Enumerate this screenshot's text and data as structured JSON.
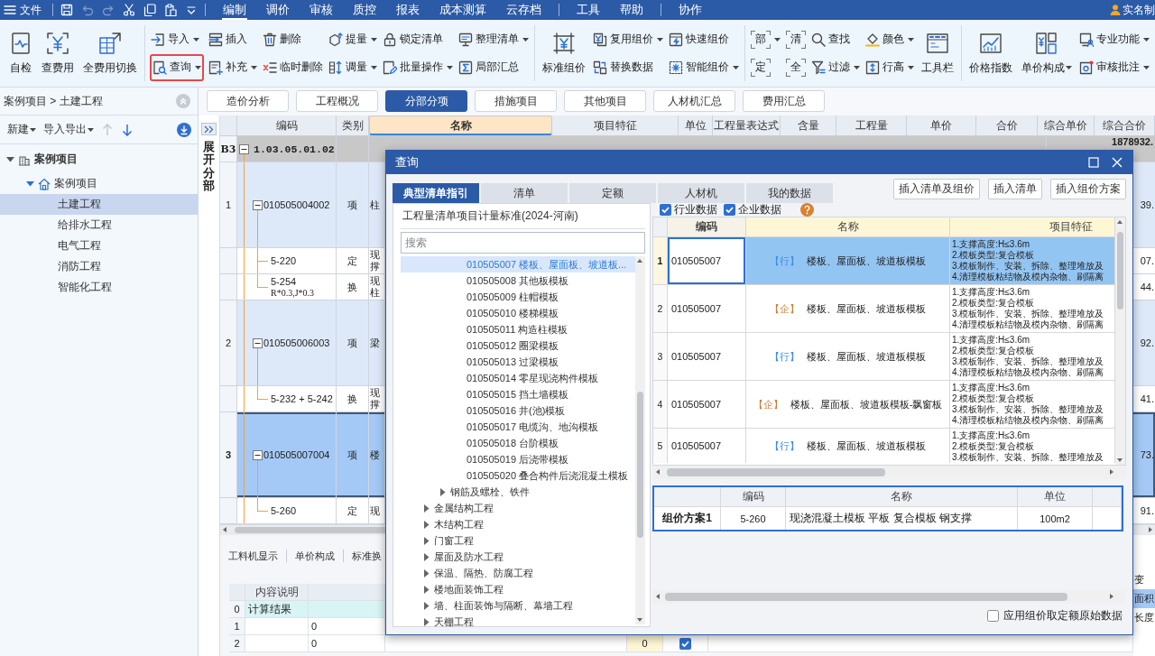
{
  "menu_bar": {
    "file_label": "文件",
    "quick_access": [
      {
        "disabled": false
      },
      {
        "disabled": true
      },
      {
        "disabled": true
      },
      {
        "disabled": false
      },
      {
        "disabled": false
      },
      {
        "disabled": false
      }
    ],
    "tab_groups": [
      [
        {
          "label": "编制",
          "selected": true
        },
        {
          "label": "调价",
          "selected": false
        },
        {
          "label": "审核",
          "selected": false
        },
        {
          "label": "质控",
          "selected": false
        },
        {
          "label": "报表",
          "selected": false
        },
        {
          "label": "成本测算",
          "selected": false
        },
        {
          "label": "云存档",
          "selected": false
        }
      ],
      [
        {
          "label": "工具",
          "selected": false
        },
        {
          "label": "帮助",
          "selected": false
        }
      ],
      [
        {
          "label": "协作",
          "selected": false
        }
      ]
    ],
    "user": "实名制"
  },
  "ribbon": {
    "groups": [
      {
        "items": [
          {
            "kind": "large",
            "label": "自检",
            "dropdown": false,
            "highlighted": false
          },
          {
            "kind": "large",
            "label": "查费用",
            "dropdown": false,
            "highlighted": false
          },
          {
            "kind": "large",
            "label": "全费用切换",
            "dropdown": false,
            "highlighted": false
          }
        ]
      },
      {
        "items": [
          {
            "kind": "small",
            "label": "导入",
            "dropdown": true,
            "highlighted": false
          },
          {
            "kind": "small",
            "label": "查询",
            "dropdown": true,
            "highlighted": true
          },
          {
            "kind": "small",
            "label": "插入",
            "dropdown": false,
            "highlighted": false
          },
          {
            "kind": "small",
            "label": "补充",
            "dropdown": true,
            "highlighted": false
          },
          {
            "kind": "small",
            "label": "删除",
            "dropdown": false,
            "highlighted": false
          },
          {
            "kind": "small",
            "label": "临时删除",
            "dropdown": false,
            "highlighted": false
          },
          {
            "kind": "small",
            "label": "提量",
            "dropdown": true,
            "highlighted": false
          },
          {
            "kind": "small",
            "label": "调量",
            "dropdown": true,
            "highlighted": false
          },
          {
            "kind": "small",
            "label": "锁定清单",
            "dropdown": false,
            "highlighted": false
          },
          {
            "kind": "small",
            "label": "批量操作",
            "dropdown": true,
            "highlighted": false
          },
          {
            "kind": "small",
            "label": "整理清单",
            "dropdown": true,
            "highlighted": false
          },
          {
            "kind": "small",
            "label": "局部汇总",
            "dropdown": false,
            "highlighted": false
          }
        ]
      },
      {
        "items": [
          {
            "kind": "large",
            "label": "标准组价",
            "dropdown": false,
            "highlighted": false
          },
          {
            "kind": "small",
            "label": "复用组价",
            "dropdown": true,
            "highlighted": false
          },
          {
            "kind": "small",
            "label": "替换数据",
            "dropdown": false,
            "highlighted": false
          },
          {
            "kind": "small",
            "label": "快速组价",
            "dropdown": false,
            "highlighted": false
          },
          {
            "kind": "small",
            "label": "智能组价",
            "dropdown": true,
            "highlighted": false
          }
        ]
      },
      {
        "items": [
          {
            "kind": "glyph",
            "label": "部",
            "dropdown": true,
            "highlighted": false
          },
          {
            "kind": "glyph",
            "label": "定",
            "dropdown": false,
            "highlighted": false
          },
          {
            "kind": "glyph",
            "label": "清",
            "dropdown": false,
            "highlighted": false
          },
          {
            "kind": "glyph",
            "label": "全",
            "dropdown": false,
            "highlighted": false
          },
          {
            "kind": "small",
            "label": "查找",
            "dropdown": false,
            "highlighted": false
          },
          {
            "kind": "small",
            "label": "过滤",
            "dropdown": true,
            "highlighted": false
          },
          {
            "kind": "small",
            "label": "颜色",
            "dropdown": true,
            "highlighted": false
          },
          {
            "kind": "small",
            "label": "行高",
            "dropdown": true,
            "highlighted": false
          },
          {
            "kind": "large",
            "label": "工具栏",
            "dropdown": false,
            "highlighted": false
          }
        ]
      },
      {
        "items": [
          {
            "kind": "large",
            "label": "价格指数",
            "dropdown": false,
            "highlighted": false
          },
          {
            "kind": "large",
            "label": "单价构成",
            "dropdown": true,
            "highlighted": false
          },
          {
            "kind": "small",
            "label": "专业功能",
            "dropdown": true,
            "highlighted": false
          },
          {
            "kind": "small",
            "label": "审核批注",
            "dropdown": true,
            "highlighted": false
          }
        ]
      }
    ]
  },
  "project_panel": {
    "breadcrumb": "案例项目 > 土建工程",
    "toolbar": [
      {
        "label": "新建",
        "dropdown": true
      },
      {
        "label": "导入导出",
        "dropdown": true
      }
    ],
    "move_buttons": [
      {
        "disabled": true
      },
      {
        "disabled": false
      }
    ],
    "tree": [
      {
        "label": "案例项目",
        "expanded": true,
        "selected": false,
        "children": [
          {
            "label": "案例项目",
            "expanded": true,
            "selected": false,
            "children": [
              {
                "label": "土建工程",
                "selected": true
              },
              {
                "label": "给排水工程",
                "selected": false
              },
              {
                "label": "电气工程",
                "selected": false
              },
              {
                "label": "消防工程",
                "selected": false
              },
              {
                "label": "智能化工程",
                "selected": false
              }
            ]
          }
        ]
      }
    ]
  },
  "view_tabs": [
    {
      "label": "造价分析",
      "selected": false
    },
    {
      "label": "工程概况",
      "selected": false
    },
    {
      "label": "分部分项",
      "selected": true
    },
    {
      "label": "措施项目",
      "selected": false
    },
    {
      "label": "其他项目",
      "selected": false
    },
    {
      "label": "人材机汇总",
      "selected": false
    },
    {
      "label": "费用汇总",
      "selected": false
    }
  ],
  "grid": {
    "side_label": "展开分部",
    "columns": [
      {
        "label": "编码",
        "active": false
      },
      {
        "label": "类别",
        "active": false
      },
      {
        "label": "名称",
        "active": true
      },
      {
        "label": "项目特征",
        "active": false
      },
      {
        "label": "单位",
        "active": false
      },
      {
        "label": "工程量表达式",
        "active": false
      },
      {
        "label": "含量",
        "active": false
      },
      {
        "label": "工程量",
        "active": false
      },
      {
        "label": "单价",
        "active": false
      },
      {
        "label": "合价",
        "active": false
      },
      {
        "label": "综合单价",
        "active": false
      },
      {
        "label": "综合合价",
        "active": false
      }
    ],
    "rows": [
      {
        "kind": "section",
        "no": "B3",
        "code": "1.03.05.01.02",
        "expanded": true,
        "selected": false,
        "total": "1878932."
      },
      {
        "kind": "item",
        "no": "1",
        "code": "010505004002",
        "type": "项",
        "name": "柱",
        "expanded": true,
        "selected": false,
        "total": "39."
      },
      {
        "kind": "sub",
        "code": "5-220",
        "type": "定",
        "name": "现撑",
        "selected": false,
        "total": "07."
      },
      {
        "kind": "sub",
        "code": "5-254",
        "code_note": "R*0.3,J*0.3",
        "type": "换",
        "name": "现柱",
        "selected": false,
        "total": "44."
      },
      {
        "kind": "item",
        "no": "2",
        "code": "010505006003",
        "type": "项",
        "name": "梁",
        "expanded": true,
        "selected": false,
        "total": "92."
      },
      {
        "kind": "sub",
        "code": "5-232 + 5-242",
        "type": "换",
        "name": "现撑",
        "selected": false,
        "total": "41."
      },
      {
        "kind": "item",
        "no": "3",
        "code": "010505007004",
        "type": "项",
        "name": "楼",
        "expanded": true,
        "selected": true,
        "total": "73."
      },
      {
        "kind": "sub",
        "code": "5-260",
        "type": "定",
        "name": "现",
        "selected": false,
        "total": "91."
      }
    ]
  },
  "detail_panel": {
    "tabs": [
      "工料机显示",
      "单价构成",
      "标准换"
    ],
    "table": {
      "columns": [
        "内容说明"
      ],
      "rows": [
        {
          "kind": "result",
          "no": "0",
          "description": "计算结果"
        },
        {
          "kind": "data",
          "no": "1",
          "column_3": "0"
        },
        {
          "kind": "data",
          "no": "2",
          "column_3": "0",
          "column_4": "0",
          "checked": true
        }
      ]
    },
    "side_labels": [
      {
        "label": "变",
        "selected": false
      },
      {
        "label": "面积",
        "selected": true
      },
      {
        "label": "长度",
        "selected": false
      }
    ]
  },
  "query_dialog": {
    "title": "查询",
    "tabs": [
      {
        "label": "典型清单指引",
        "selected": true
      },
      {
        "label": "清单",
        "selected": false
      },
      {
        "label": "定额",
        "selected": false
      },
      {
        "label": "人材机",
        "selected": false
      },
      {
        "label": "我的数据",
        "selected": false
      }
    ],
    "actions": [
      "插入清单及组价",
      "插入清单",
      "插入组价方案"
    ],
    "guide": {
      "standard": "工程量清单项目计量标准(2024-河南)",
      "search": {
        "placeholder": "搜索"
      },
      "tree": [
        {
          "children": [
            {
              "children": [
                {
                  "label": "010505007 楼板、屋面板、坡道板...",
                  "selected": true
                },
                {
                  "label": "010505008 其他板模板",
                  "selected": false
                },
                {
                  "label": "010505009 柱帽模板",
                  "selected": false
                },
                {
                  "label": "010505010 楼梯模板",
                  "selected": false
                },
                {
                  "label": "010505011 构造柱模板",
                  "selected": false
                },
                {
                  "label": "010505012 圈梁模板",
                  "selected": false
                },
                {
                  "label": "010505013 过梁模板",
                  "selected": false
                },
                {
                  "label": "010505014 零星现浇构件模板",
                  "selected": false
                },
                {
                  "label": "010505015 挡土墙模板",
                  "selected": false
                },
                {
                  "label": "010505016 井(池)模板",
                  "selected": false
                },
                {
                  "label": "010505017 电缆沟、地沟模板",
                  "selected": false
                },
                {
                  "label": "010505018 台阶模板",
                  "selected": false
                },
                {
                  "label": "010505019 后浇带模板",
                  "selected": false
                },
                {
                  "label": "010505020 叠合构件后浇混凝土模板",
                  "selected": false
                }
              ]
            },
            {
              "label": "钢筋及螺栓、铁件",
              "expanded": false,
              "selected": false
            }
          ]
        },
        {
          "label": "金属结构工程",
          "expanded": false,
          "selected": false
        },
        {
          "label": "木结构工程",
          "expanded": false,
          "selected": false
        },
        {
          "label": "门窗工程",
          "expanded": false,
          "selected": false
        },
        {
          "label": "屋面及防水工程",
          "expanded": false,
          "selected": false
        },
        {
          "label": "保温、隔热、防腐工程",
          "expanded": false,
          "selected": false
        },
        {
          "label": "楼地面装饰工程",
          "expanded": false,
          "selected": false
        },
        {
          "label": "墙、柱面装饰与隔断、幕墙工程",
          "expanded": false,
          "selected": false
        },
        {
          "label": "天棚工程",
          "expanded": false,
          "selected": false
        }
      ]
    },
    "filters": [
      {
        "label": "行业数据",
        "checked": true
      },
      {
        "label": "企业数据",
        "checked": true
      }
    ],
    "results": {
      "columns": [
        "编码",
        "名称",
        "项目特征"
      ],
      "rows": [
        {
          "no": "1",
          "code": "010505007",
          "tag": "【行】",
          "color": "#3c8ce6",
          "name": "楼板、屋面板、坡道板模板",
          "features": [
            "1.支撑高度:H≤3.6m",
            "2.模板类型:复合模板",
            "3.模板制作、安装、拆除、整理堆放及",
            "4.清理模板粘结物及模内杂物、刷隔离"
          ],
          "selected": true
        },
        {
          "no": "2",
          "code": "010505007",
          "tag": "【企】",
          "color": "#c8803a",
          "name": "楼板、屋面板、坡道板模板",
          "features": [
            "1.支撑高度:H≤3.6m",
            "2.模板类型:复合模板",
            "3.模板制作、安装、拆除、整理堆放及",
            "4.清理模板粘结物及模内杂物、刷隔离"
          ],
          "selected": false
        },
        {
          "no": "3",
          "code": "010505007",
          "tag": "【行】",
          "color": "#3c8ce6",
          "name": "楼板、屋面板、坡道板模板",
          "features": [
            "1.支撑高度:H≤3.6m",
            "2.模板类型:复合模板",
            "3.模板制作、安装、拆除、整理堆放及",
            "4.清理模板粘结物及模内杂物、刷隔离"
          ],
          "selected": false
        },
        {
          "no": "4",
          "code": "010505007",
          "tag": "【企】",
          "color": "#c8803a",
          "name": "楼板、屋面板、坡道板模板-飘窗板",
          "features": [
            "1.支撑高度:H≤3.6m",
            "2.模板类型:复合模板",
            "3.模板制作、安装、拆除、整理堆放及",
            "4.清理模板粘结物及模内杂物、刷隔离"
          ],
          "selected": false
        },
        {
          "no": "5",
          "code": "010505007",
          "tag": "【行】",
          "color": "#3c8ce6",
          "name": "楼板、屋面板、坡道板模板",
          "features": [
            "1.支撑高度:H≤3.6m",
            "2.模板类型:复合模板",
            "3.模板制作、安装、拆除、整理堆放及"
          ],
          "selected": false
        }
      ]
    },
    "plans": {
      "columns": [
        "编码",
        "名称",
        "单位"
      ],
      "rows": [
        {
          "label": "组价方案1",
          "code": "5-260",
          "name": "现浇混凝土模板 平板 复合模板 钢支撑",
          "unit": "100m2"
        }
      ]
    },
    "apply_option": {
      "label": "应用组价取定额原始数据",
      "checked": false
    }
  }
}
